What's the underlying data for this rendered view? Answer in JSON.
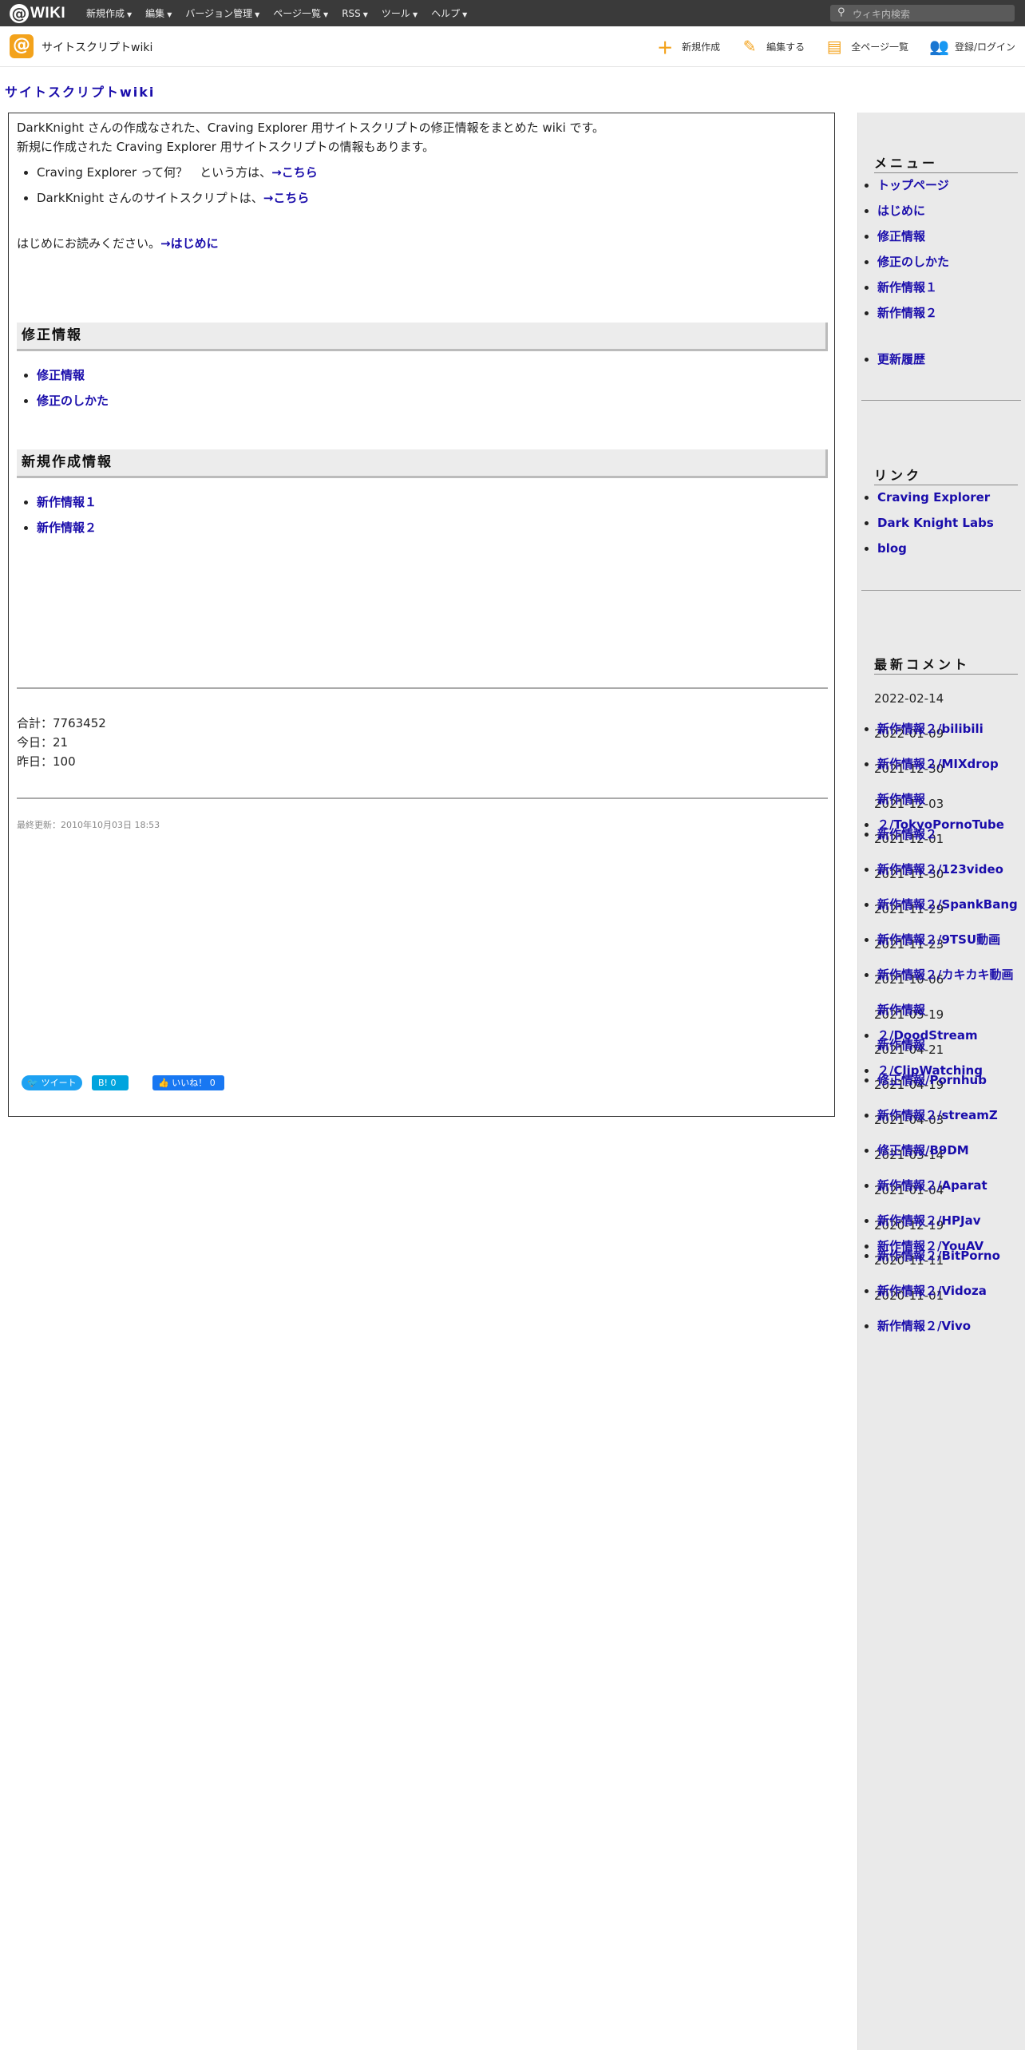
{
  "topbar": {
    "logo_text": "WIKI",
    "menu": [
      "新規作成",
      "編集",
      "バージョン管理",
      "ページ一覧",
      "RSS",
      "ツール",
      "ヘルプ"
    ],
    "search_placeholder": "ウィキ内検索"
  },
  "sitebar": {
    "site_name": "サイトスクリプトwiki",
    "actions": [
      "新規作成",
      "編集する",
      "全ページ一覧",
      "登録/ログイン"
    ]
  },
  "page_title": "サイトスクリプトwiki",
  "main": {
    "intro_line1": "DarkKnight さんの作成なされた、Craving Explorer 用サイトスクリプトの修正情報をまとめた wiki です。",
    "intro_line2": "新規に作成された Craving Explorer 用サイトスクリプトの情報もあります。",
    "bullets": [
      {
        "text": "Craving Explorer って何？　という方は、",
        "link": "→こちら"
      },
      {
        "text": "DarkKnight さんのサイトスクリプトは、",
        "link": "→こちら"
      }
    ],
    "read_first_text": "はじめにお読みください。",
    "read_first_link": "→はじめに",
    "section1_title": "修正情報",
    "section1_links": [
      "修正情報",
      "修正のしかた"
    ],
    "section2_title": "新規作成情報",
    "section2_links": [
      "新作情報１",
      "新作情報２"
    ],
    "counter_total": "合計：7763452",
    "counter_today": "今日：21",
    "counter_yesterday": "昨日：100",
    "last_modified": "最終更新：2010年10月03日 18:53",
    "social": {
      "tweet": "ツイート",
      "hatena": "B! 0",
      "like": "いいね！ 0"
    }
  },
  "sidebar": {
    "menu_title": "メニュー",
    "menu_items": [
      "トップページ",
      "はじめに",
      "修正情報",
      "修正のしかた",
      "新作情報１",
      "新作情報２"
    ],
    "history": "更新履歴",
    "links_title": "リンク",
    "links": [
      "Craving Explorer",
      "Dark Knight Labs",
      "blog"
    ],
    "comments_title": "最新コメント",
    "comments": [
      {
        "date": "2022-02-14",
        "items": [
          "新作情報２/bilibili"
        ]
      },
      {
        "date": "2022-01-09",
        "items": [
          "新作情報２/MIXdrop"
        ]
      },
      {
        "date": "2021-12-30",
        "items": [
          "新作情報 ２/TokyoPornoTube"
        ]
      },
      {
        "date": "2021-12-03",
        "items": [
          "新作情報２"
        ]
      },
      {
        "date": "2021-12-01",
        "items": [
          "新作情報２/123video"
        ]
      },
      {
        "date": "2021-11-30",
        "items": [
          "新作情報２/SpankBang"
        ]
      },
      {
        "date": "2021-11-29",
        "items": [
          "新作情報２/9TSU動画"
        ]
      },
      {
        "date": "2021-11-23",
        "items": [
          "新作情報２/カキカキ動画"
        ]
      },
      {
        "date": "2021-10-06",
        "items": [
          "新作情報 ２/DoodStream"
        ]
      },
      {
        "date": "2021-05-19",
        "items": [
          "新作情報 ２/ClipWatching"
        ]
      },
      {
        "date": "2021-04-21",
        "items": [
          "修正情報/Pornhub"
        ]
      },
      {
        "date": "2021-04-19",
        "items": [
          "新作情報２/streamZ"
        ]
      },
      {
        "date": "2021-04-03",
        "items": [
          "修正情報/B9DM"
        ]
      },
      {
        "date": "2021-03-14",
        "items": [
          "新作情報２/Aparat"
        ]
      },
      {
        "date": "2021-01-04",
        "items": [
          "新作情報２/HPJav",
          "新作情報２/YouAV"
        ]
      },
      {
        "date": "2020-12-19",
        "items": [
          "新作情報２/BitPorno"
        ]
      },
      {
        "date": "2020-11-11",
        "items": [
          "新作情報２/Vidoza"
        ]
      },
      {
        "date": "2020-11-01",
        "items": [
          "新作情報２/Vivo"
        ]
      }
    ]
  }
}
